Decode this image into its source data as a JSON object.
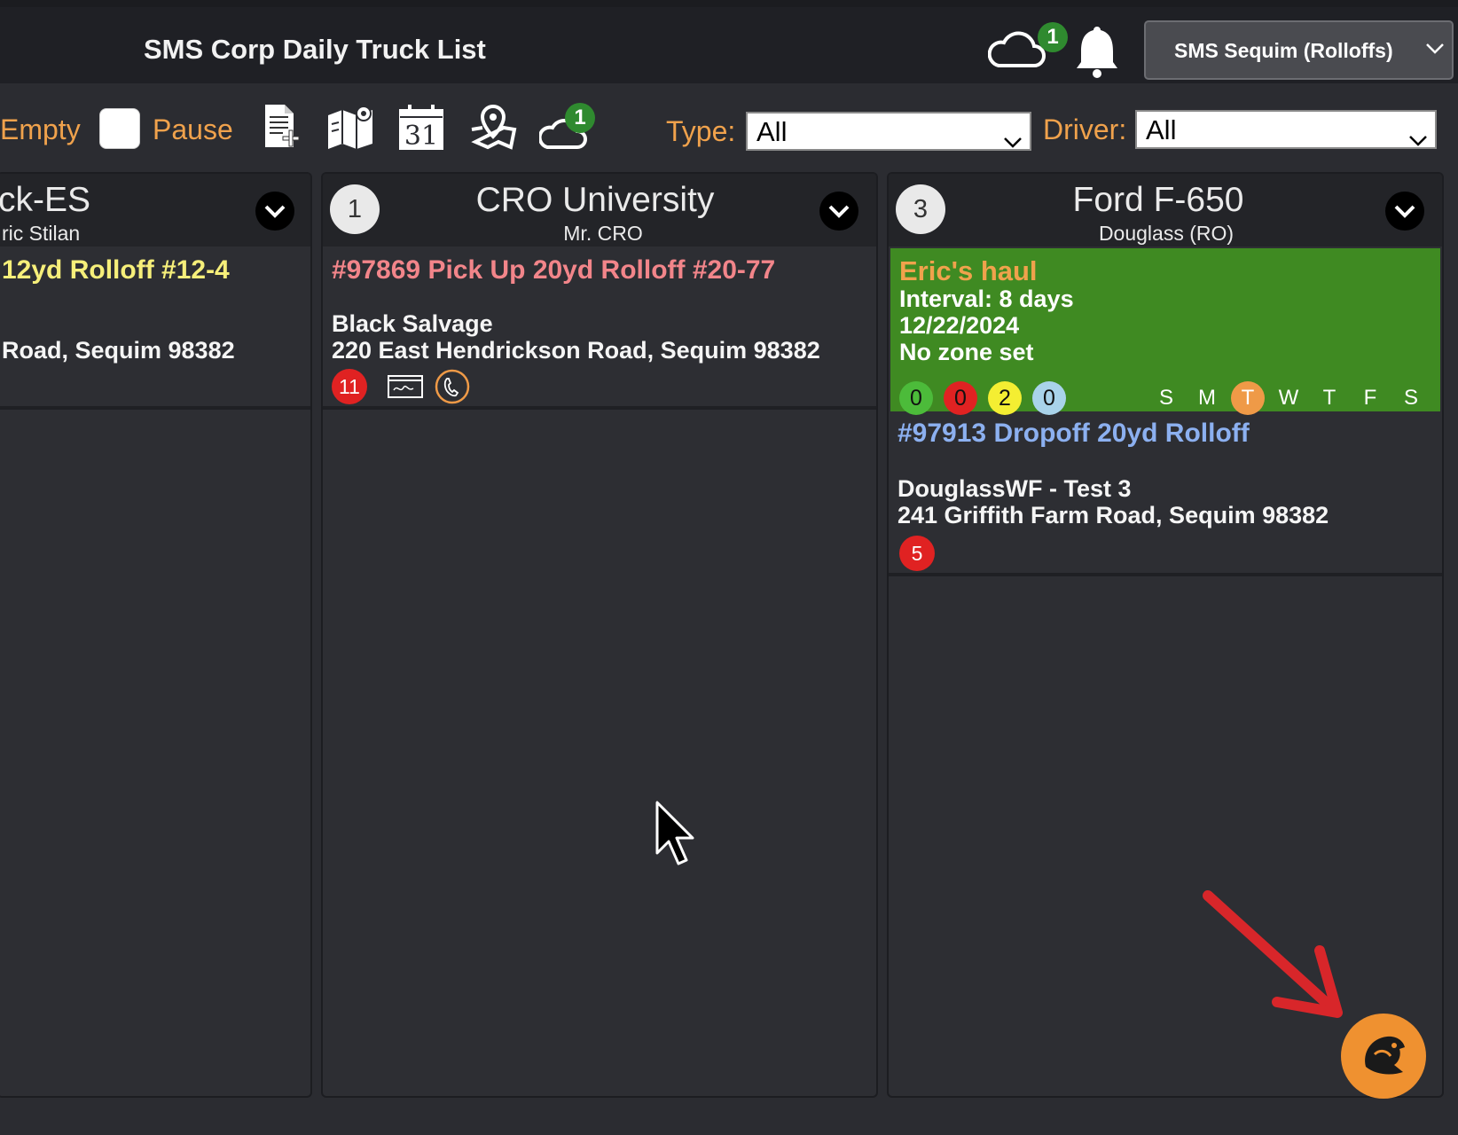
{
  "header": {
    "title": "SMS Corp Daily Truck List",
    "cloud_badge": "1",
    "location": "SMS Sequim (Rolloffs)"
  },
  "toolbar": {
    "empty_label": "Empty",
    "pause_label": "Pause",
    "cloud_badge": "1",
    "calendar_day": "31",
    "type_label": "Type:",
    "type_value": "All",
    "driver_label": "Driver:",
    "driver_value": "All"
  },
  "columns": [
    {
      "title": "ck-ES",
      "subtitle": "ric Stilan",
      "jobs": [
        {
          "title": "12yd Rolloff #12-4",
          "address": "Road, Sequim 98382"
        }
      ]
    },
    {
      "number": "1",
      "title": "CRO University",
      "subtitle": "Mr. CRO",
      "jobs": [
        {
          "title": "#97869 Pick Up 20yd Rolloff #20-77",
          "customer": "Black Salvage",
          "address": "220 East Hendrickson Road, Sequim 98382",
          "badge": "11"
        }
      ]
    },
    {
      "number": "3",
      "title": "Ford F-650",
      "subtitle": "Douglass (RO)",
      "route": {
        "title": "Eric's haul",
        "interval": "Interval: 8 days",
        "date": "12/22/2024",
        "zone": "No zone set",
        "counts": [
          "0",
          "0",
          "2",
          "0"
        ],
        "count_colors": [
          "#4cbb3a",
          "#e02222",
          "#f4ee32",
          "#a9d3ea"
        ],
        "days": [
          "S",
          "M",
          "T",
          "W",
          "T",
          "F",
          "S"
        ],
        "active_day_index": 2
      },
      "jobs": [
        {
          "title": "#97913 Dropoff 20yd Rolloff",
          "customer": "DouglassWF - Test 3",
          "address": "241 Griffith Farm Road, Sequim 98382",
          "badge": "5"
        }
      ]
    }
  ]
}
